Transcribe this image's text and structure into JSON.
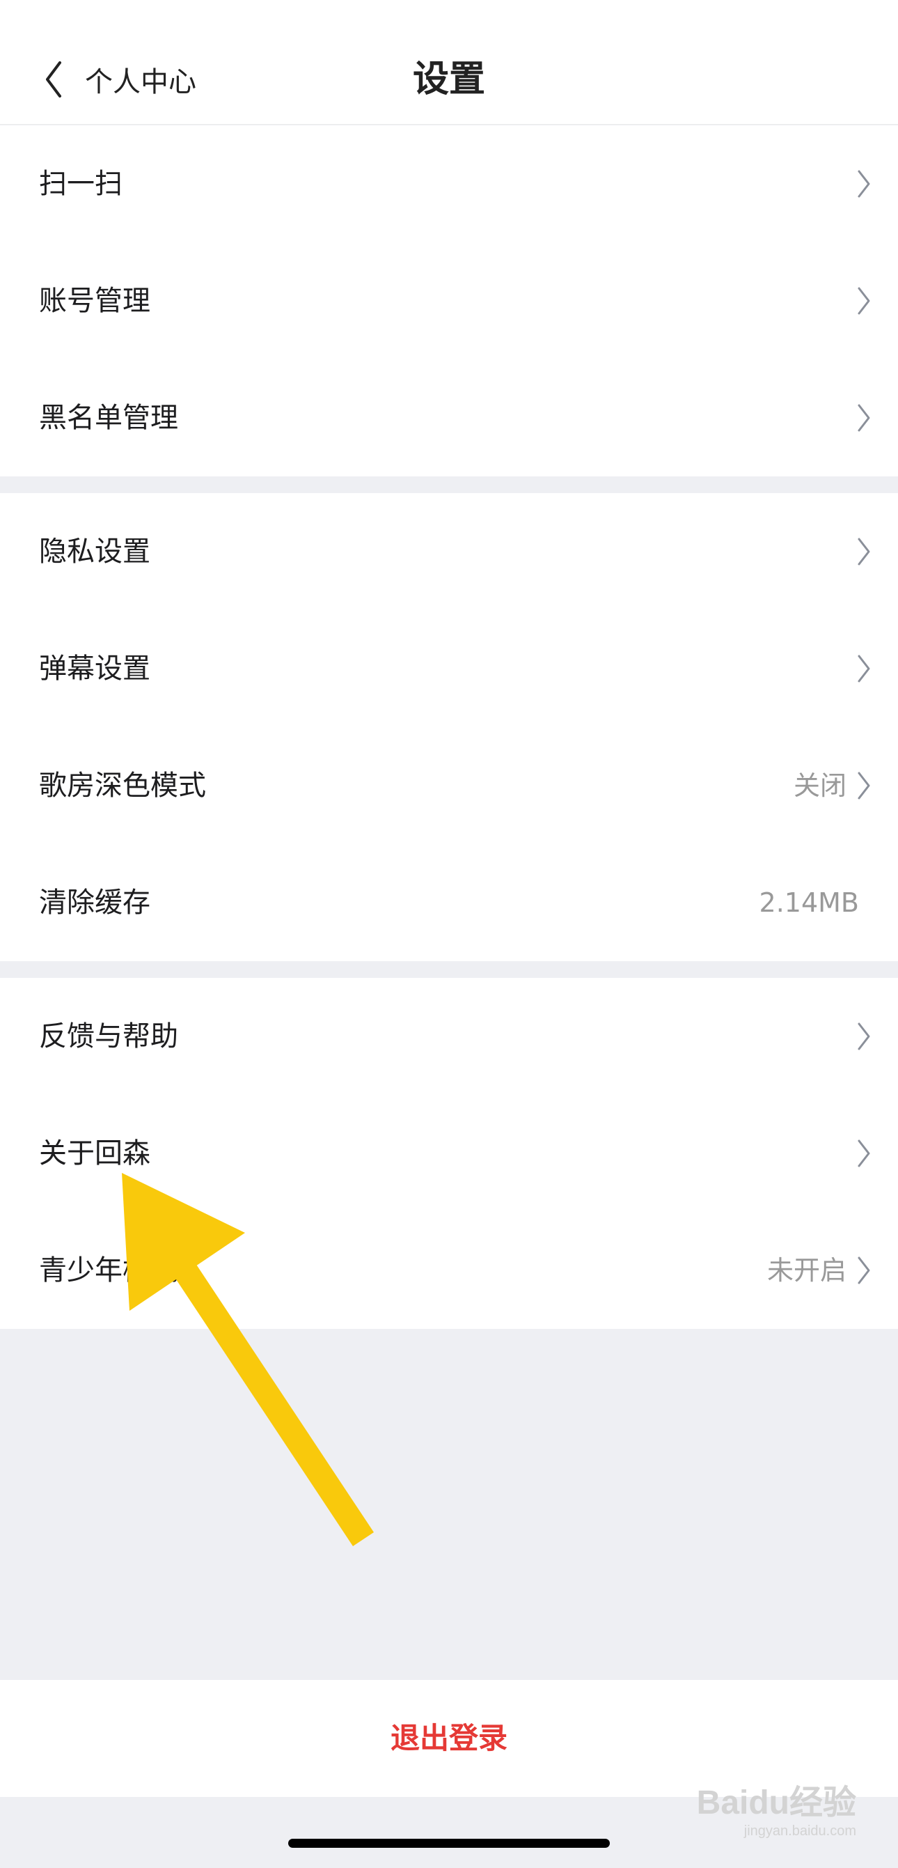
{
  "nav": {
    "back_label": "个人中心",
    "title": "设置"
  },
  "group1": [
    {
      "label": "扫一扫"
    },
    {
      "label": "账号管理"
    },
    {
      "label": "黑名单管理"
    }
  ],
  "group2": [
    {
      "label": "隐私设置"
    },
    {
      "label": "弹幕设置"
    },
    {
      "label": "歌房深色模式",
      "value": "关闭"
    },
    {
      "label": "清除缓存",
      "value": "2.14MB"
    }
  ],
  "group3": [
    {
      "label": "反馈与帮助"
    },
    {
      "label": "关于回森"
    },
    {
      "label": "青少年模式",
      "value": "未开启"
    }
  ],
  "logout_label": "退出登录",
  "overlay": {
    "arrow_color": "#f9c90c"
  },
  "watermark": {
    "main": "Baidu经验",
    "sub": "jingyan.baidu.com"
  }
}
